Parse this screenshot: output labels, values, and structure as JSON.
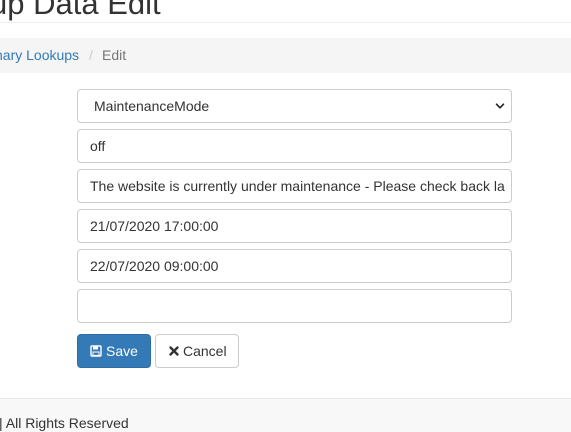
{
  "header": {
    "title": "up Data Edit"
  },
  "breadcrumb": {
    "parent_label": "nary Lookups",
    "separator": "/",
    "current_label": "Edit"
  },
  "form": {
    "lookup_type": {
      "selected": "MaintenanceMode",
      "icon": "chevron-down-icon"
    },
    "value": "off",
    "description": "The website is currently under maintenance - Please check back la",
    "start_date": "21/07/2020 17:00:00",
    "end_date": "22/07/2020 09:00:00",
    "extra": ""
  },
  "buttons": {
    "save_label": "Save",
    "save_icon": "floppy-disk-icon",
    "cancel_label": "Cancel",
    "cancel_icon": "close-icon"
  },
  "footer": {
    "text": "| All Rights Reserved"
  },
  "colors": {
    "primary": "#337ab7",
    "breadcrumb_bg": "#f5f5f5",
    "footer_bg": "#f8f8f8",
    "border": "#cccccc"
  }
}
